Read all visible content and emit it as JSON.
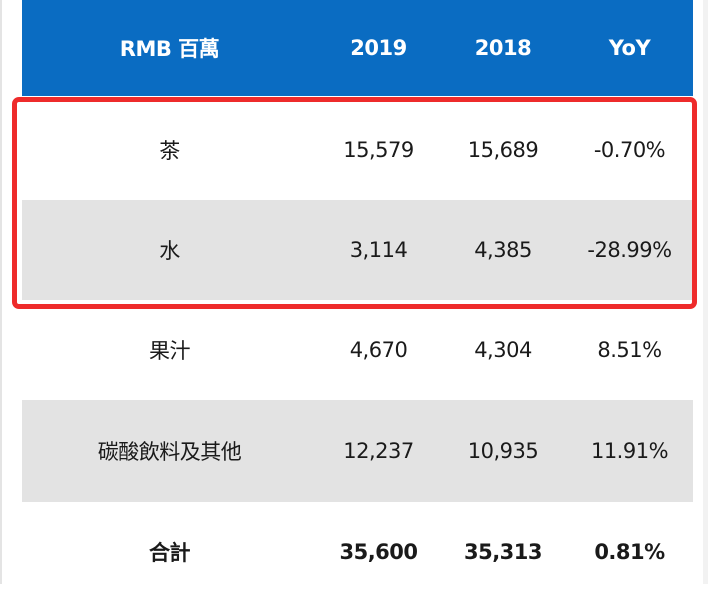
{
  "chart_data": {
    "type": "table",
    "columns": [
      "RMB 百萬",
      "2019",
      "2018",
      "YoY"
    ],
    "rows": [
      {
        "category": "茶",
        "v2019": "15,579",
        "v2018": "15,689",
        "yoy": "-0.70%"
      },
      {
        "category": "水",
        "v2019": "3,114",
        "v2018": "4,385",
        "yoy": "-28.99%"
      },
      {
        "category": "果汁",
        "v2019": "4,670",
        "v2018": "4,304",
        "yoy": "8.51%"
      },
      {
        "category": "碳酸飲料及其他",
        "v2019": "12,237",
        "v2018": "10,935",
        "yoy": "11.91%"
      },
      {
        "category": "合計",
        "v2019": "35,600",
        "v2018": "35,313",
        "yoy": "0.81%"
      }
    ],
    "highlighted_rows": [
      "茶",
      "水"
    ]
  },
  "colors": {
    "header_bg": "#0a6cc2",
    "header_text": "#ffffff",
    "row_alt_bg": "#e3e3e3",
    "highlight_border": "#ee2b2b"
  }
}
